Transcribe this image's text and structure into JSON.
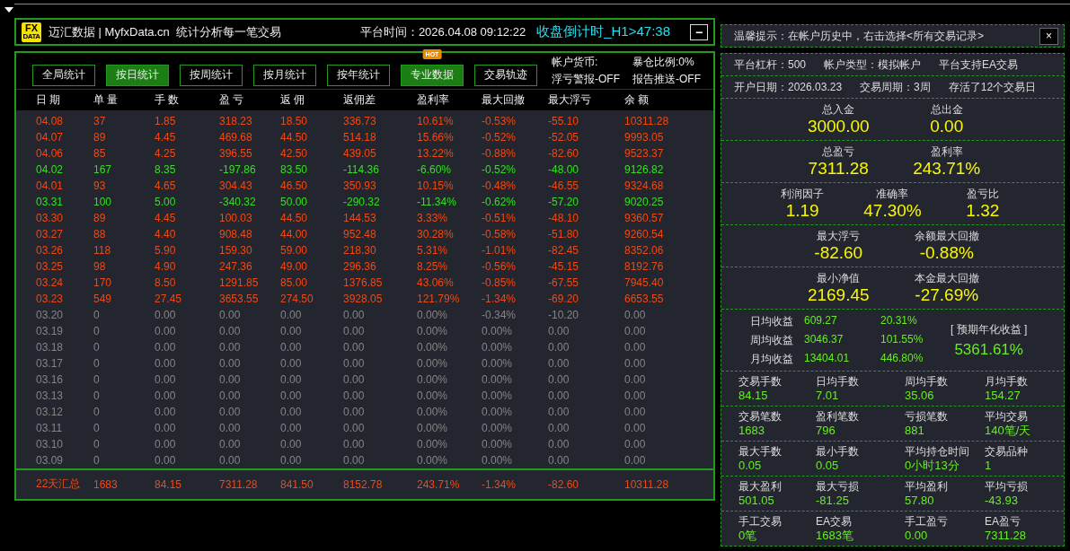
{
  "header": {
    "logo_top": "FX",
    "logo_bottom": "DATA",
    "title": "迈汇数据 | MyfxData.cn  统计分析每一笔交易",
    "platform_time": "平台时间：2026.04.08 09:12:22",
    "countdown": "收盘倒计时_H1>47:38",
    "minimize": "−"
  },
  "tabs": [
    {
      "label": "全局统计",
      "selected": false
    },
    {
      "label": "按日统计",
      "selected": true
    },
    {
      "label": "按周统计",
      "selected": false
    },
    {
      "label": "按月统计",
      "selected": false
    },
    {
      "label": "按年统计",
      "selected": false
    },
    {
      "label": "专业数据",
      "selected": true,
      "badge": "HOT"
    },
    {
      "label": "交易轨迹",
      "selected": false
    }
  ],
  "account_flags": [
    "帐户货币:",
    "暴仓比例:0%",
    "浮亏警报-OFF",
    "报告推送-OFF"
  ],
  "table": {
    "columns": [
      "日 期",
      "单 量",
      "手 数",
      "盈 亏",
      "返 佣",
      "返佣差",
      "盈利率",
      "最大回撤",
      "最大浮亏",
      "余 额"
    ],
    "rows": [
      {
        "kind": "profit",
        "cells": [
          "04.08",
          "37",
          "1.85",
          "318.23",
          "18.50",
          "336.73",
          "10.61%",
          "-0.53%",
          "-55.10",
          "10311.28"
        ]
      },
      {
        "kind": "profit",
        "cells": [
          "04.07",
          "89",
          "4.45",
          "469.68",
          "44.50",
          "514.18",
          "15.66%",
          "-0.52%",
          "-52.05",
          "9993.05"
        ]
      },
      {
        "kind": "profit",
        "cells": [
          "04.06",
          "85",
          "4.25",
          "396.55",
          "42.50",
          "439.05",
          "13.22%",
          "-0.88%",
          "-82.60",
          "9523.37"
        ]
      },
      {
        "kind": "loss",
        "cells": [
          "04.02",
          "167",
          "8.35",
          "-197.86",
          "83.50",
          "-114.36",
          "-6.60%",
          "-0.52%",
          "-48.00",
          "9126.82"
        ]
      },
      {
        "kind": "profit",
        "cells": [
          "04.01",
          "93",
          "4.65",
          "304.43",
          "46.50",
          "350.93",
          "10.15%",
          "-0.48%",
          "-46.55",
          "9324.68"
        ]
      },
      {
        "kind": "loss",
        "cells": [
          "03.31",
          "100",
          "5.00",
          "-340.32",
          "50.00",
          "-290.32",
          "-11.34%",
          "-0.62%",
          "-57.20",
          "9020.25"
        ]
      },
      {
        "kind": "profit",
        "cells": [
          "03.30",
          "89",
          "4.45",
          "100.03",
          "44.50",
          "144.53",
          "3.33%",
          "-0.51%",
          "-48.10",
          "9360.57"
        ]
      },
      {
        "kind": "profit",
        "cells": [
          "03.27",
          "88",
          "4.40",
          "908.48",
          "44.00",
          "952.48",
          "30.28%",
          "-0.58%",
          "-51.80",
          "9260.54"
        ]
      },
      {
        "kind": "profit",
        "cells": [
          "03.26",
          "118",
          "5.90",
          "159.30",
          "59.00",
          "218.30",
          "5.31%",
          "-1.01%",
          "-82.45",
          "8352.06"
        ]
      },
      {
        "kind": "profit",
        "cells": [
          "03.25",
          "98",
          "4.90",
          "247.36",
          "49.00",
          "296.36",
          "8.25%",
          "-0.56%",
          "-45.15",
          "8192.76"
        ]
      },
      {
        "kind": "profit",
        "cells": [
          "03.24",
          "170",
          "8.50",
          "1291.85",
          "85.00",
          "1376.85",
          "43.06%",
          "-0.85%",
          "-67.55",
          "7945.40"
        ]
      },
      {
        "kind": "profit",
        "cells": [
          "03.23",
          "549",
          "27.45",
          "3653.55",
          "274.50",
          "3928.05",
          "121.79%",
          "-1.34%",
          "-69.20",
          "6653.55"
        ]
      },
      {
        "kind": "zero",
        "cells": [
          "03.20",
          "0",
          "0.00",
          "0.00",
          "0.00",
          "0.00",
          "0.00%",
          "-0.34%",
          "-10.20",
          "0.00"
        ]
      },
      {
        "kind": "zero",
        "cells": [
          "03.19",
          "0",
          "0.00",
          "0.00",
          "0.00",
          "0.00",
          "0.00%",
          "0.00%",
          "0.00",
          "0.00"
        ]
      },
      {
        "kind": "zero",
        "cells": [
          "03.18",
          "0",
          "0.00",
          "0.00",
          "0.00",
          "0.00",
          "0.00%",
          "0.00%",
          "0.00",
          "0.00"
        ]
      },
      {
        "kind": "zero",
        "cells": [
          "03.17",
          "0",
          "0.00",
          "0.00",
          "0.00",
          "0.00",
          "0.00%",
          "0.00%",
          "0.00",
          "0.00"
        ]
      },
      {
        "kind": "zero",
        "cells": [
          "03.16",
          "0",
          "0.00",
          "0.00",
          "0.00",
          "0.00",
          "0.00%",
          "0.00%",
          "0.00",
          "0.00"
        ]
      },
      {
        "kind": "zero",
        "cells": [
          "03.13",
          "0",
          "0.00",
          "0.00",
          "0.00",
          "0.00",
          "0.00%",
          "0.00%",
          "0.00",
          "0.00"
        ]
      },
      {
        "kind": "zero",
        "cells": [
          "03.12",
          "0",
          "0.00",
          "0.00",
          "0.00",
          "0.00",
          "0.00%",
          "0.00%",
          "0.00",
          "0.00"
        ]
      },
      {
        "kind": "zero",
        "cells": [
          "03.11",
          "0",
          "0.00",
          "0.00",
          "0.00",
          "0.00",
          "0.00%",
          "0.00%",
          "0.00",
          "0.00"
        ]
      },
      {
        "kind": "zero",
        "cells": [
          "03.10",
          "0",
          "0.00",
          "0.00",
          "0.00",
          "0.00",
          "0.00%",
          "0.00%",
          "0.00",
          "0.00"
        ]
      },
      {
        "kind": "zero",
        "cells": [
          "03.09",
          "0",
          "0.00",
          "0.00",
          "0.00",
          "0.00",
          "0.00%",
          "0.00%",
          "0.00",
          "0.00"
        ]
      }
    ],
    "summary": [
      "22天汇总",
      "1683",
      "84.15",
      "7311.28",
      "841.50",
      "8152.78",
      "243.71%",
      "-1.34%",
      "-82.60",
      "10311.28"
    ]
  },
  "tip": {
    "text": "温馨提示：在帐户历史中，右击选择<所有交易记录>",
    "close": "×"
  },
  "info_rows": [
    [
      "平台杠杆：500",
      "帐户类型：模拟帐户",
      "平台支持EA交易"
    ],
    [
      "开户日期：2026.03.23",
      "交易周期：3周",
      "存活了12个交易日"
    ]
  ],
  "big_stats": [
    [
      {
        "label": "总入金",
        "value": "3000.00"
      },
      {
        "label": "总出金",
        "value": "0.00"
      }
    ],
    [
      {
        "label": "总盈亏",
        "value": "7311.28"
      },
      {
        "label": "盈利率",
        "value": "243.71%"
      }
    ],
    [
      {
        "label": "利润因子",
        "value": "1.19"
      },
      {
        "label": "准确率",
        "value": "47.30%"
      },
      {
        "label": "盈亏比",
        "value": "1.32"
      }
    ],
    [
      {
        "label": "最大浮亏",
        "value": "-82.60"
      },
      {
        "label": "余额最大回撤",
        "value": "-0.88%"
      }
    ],
    [
      {
        "label": "最小净值",
        "value": "2169.45"
      },
      {
        "label": "本金最大回撤",
        "value": "-27.69%"
      }
    ]
  ],
  "returns": {
    "rows": [
      {
        "label": "日均收益",
        "amount": "609.27",
        "percent": "20.31%"
      },
      {
        "label": "周均收益",
        "amount": "3046.37",
        "percent": "101.55%"
      },
      {
        "label": "月均收益",
        "amount": "13404.01",
        "percent": "446.80%"
      }
    ],
    "annual_label": "[ 预期年化收益 ]",
    "annual_value": "5361.61%"
  },
  "stat_groups": [
    [
      {
        "label": "交易手数",
        "value": "84.15"
      },
      {
        "label": "日均手数",
        "value": "7.01"
      },
      {
        "label": "周均手数",
        "value": "35.06"
      },
      {
        "label": "月均手数",
        "value": "154.27"
      }
    ],
    [
      {
        "label": "交易笔数",
        "value": "1683"
      },
      {
        "label": "盈利笔数",
        "value": "796"
      },
      {
        "label": "亏损笔数",
        "value": "881"
      },
      {
        "label": "平均交易",
        "value": "140笔/天"
      }
    ],
    [
      {
        "label": "最大手数",
        "value": "0.05"
      },
      {
        "label": "最小手数",
        "value": "0.05"
      },
      {
        "label": "平均持仓时间",
        "value": "0小时13分"
      },
      {
        "label": "交易品种",
        "value": "1"
      }
    ],
    [
      {
        "label": "最大盈利",
        "value": "501.05"
      },
      {
        "label": "最大亏损",
        "value": "-81.25"
      },
      {
        "label": "平均盈利",
        "value": "57.80"
      },
      {
        "label": "平均亏损",
        "value": "-43.93"
      }
    ],
    [
      {
        "label": "手工交易",
        "value": "0笔"
      },
      {
        "label": "EA交易",
        "value": "1683笔"
      },
      {
        "label": "手工盈亏",
        "value": "0.00"
      },
      {
        "label": "EA盈亏",
        "value": "7311.28"
      }
    ]
  ]
}
